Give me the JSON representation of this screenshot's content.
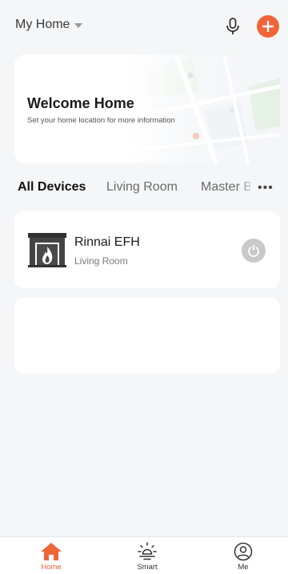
{
  "header": {
    "home_name": "My Home",
    "mic_icon": "microphone-icon",
    "add_icon": "plus-icon",
    "accent_color": "#f0643a"
  },
  "welcome": {
    "title": "Welcome Home",
    "subtitle": "Set your home location for more information"
  },
  "tabs": [
    {
      "label": "All Devices",
      "active": true
    },
    {
      "label": "Living Room",
      "active": false
    },
    {
      "label": "Master Be",
      "active": false
    }
  ],
  "tabs_more": "•••",
  "devices": [
    {
      "name": "Rinnai EFH",
      "room": "Living Room",
      "icon": "fireplace-icon",
      "power": "off"
    }
  ],
  "bottom_nav": [
    {
      "label": "Home",
      "icon": "home-icon",
      "active": true
    },
    {
      "label": "Smart",
      "icon": "sun-icon",
      "active": false
    },
    {
      "label": "Me",
      "icon": "user-icon",
      "active": false
    }
  ]
}
